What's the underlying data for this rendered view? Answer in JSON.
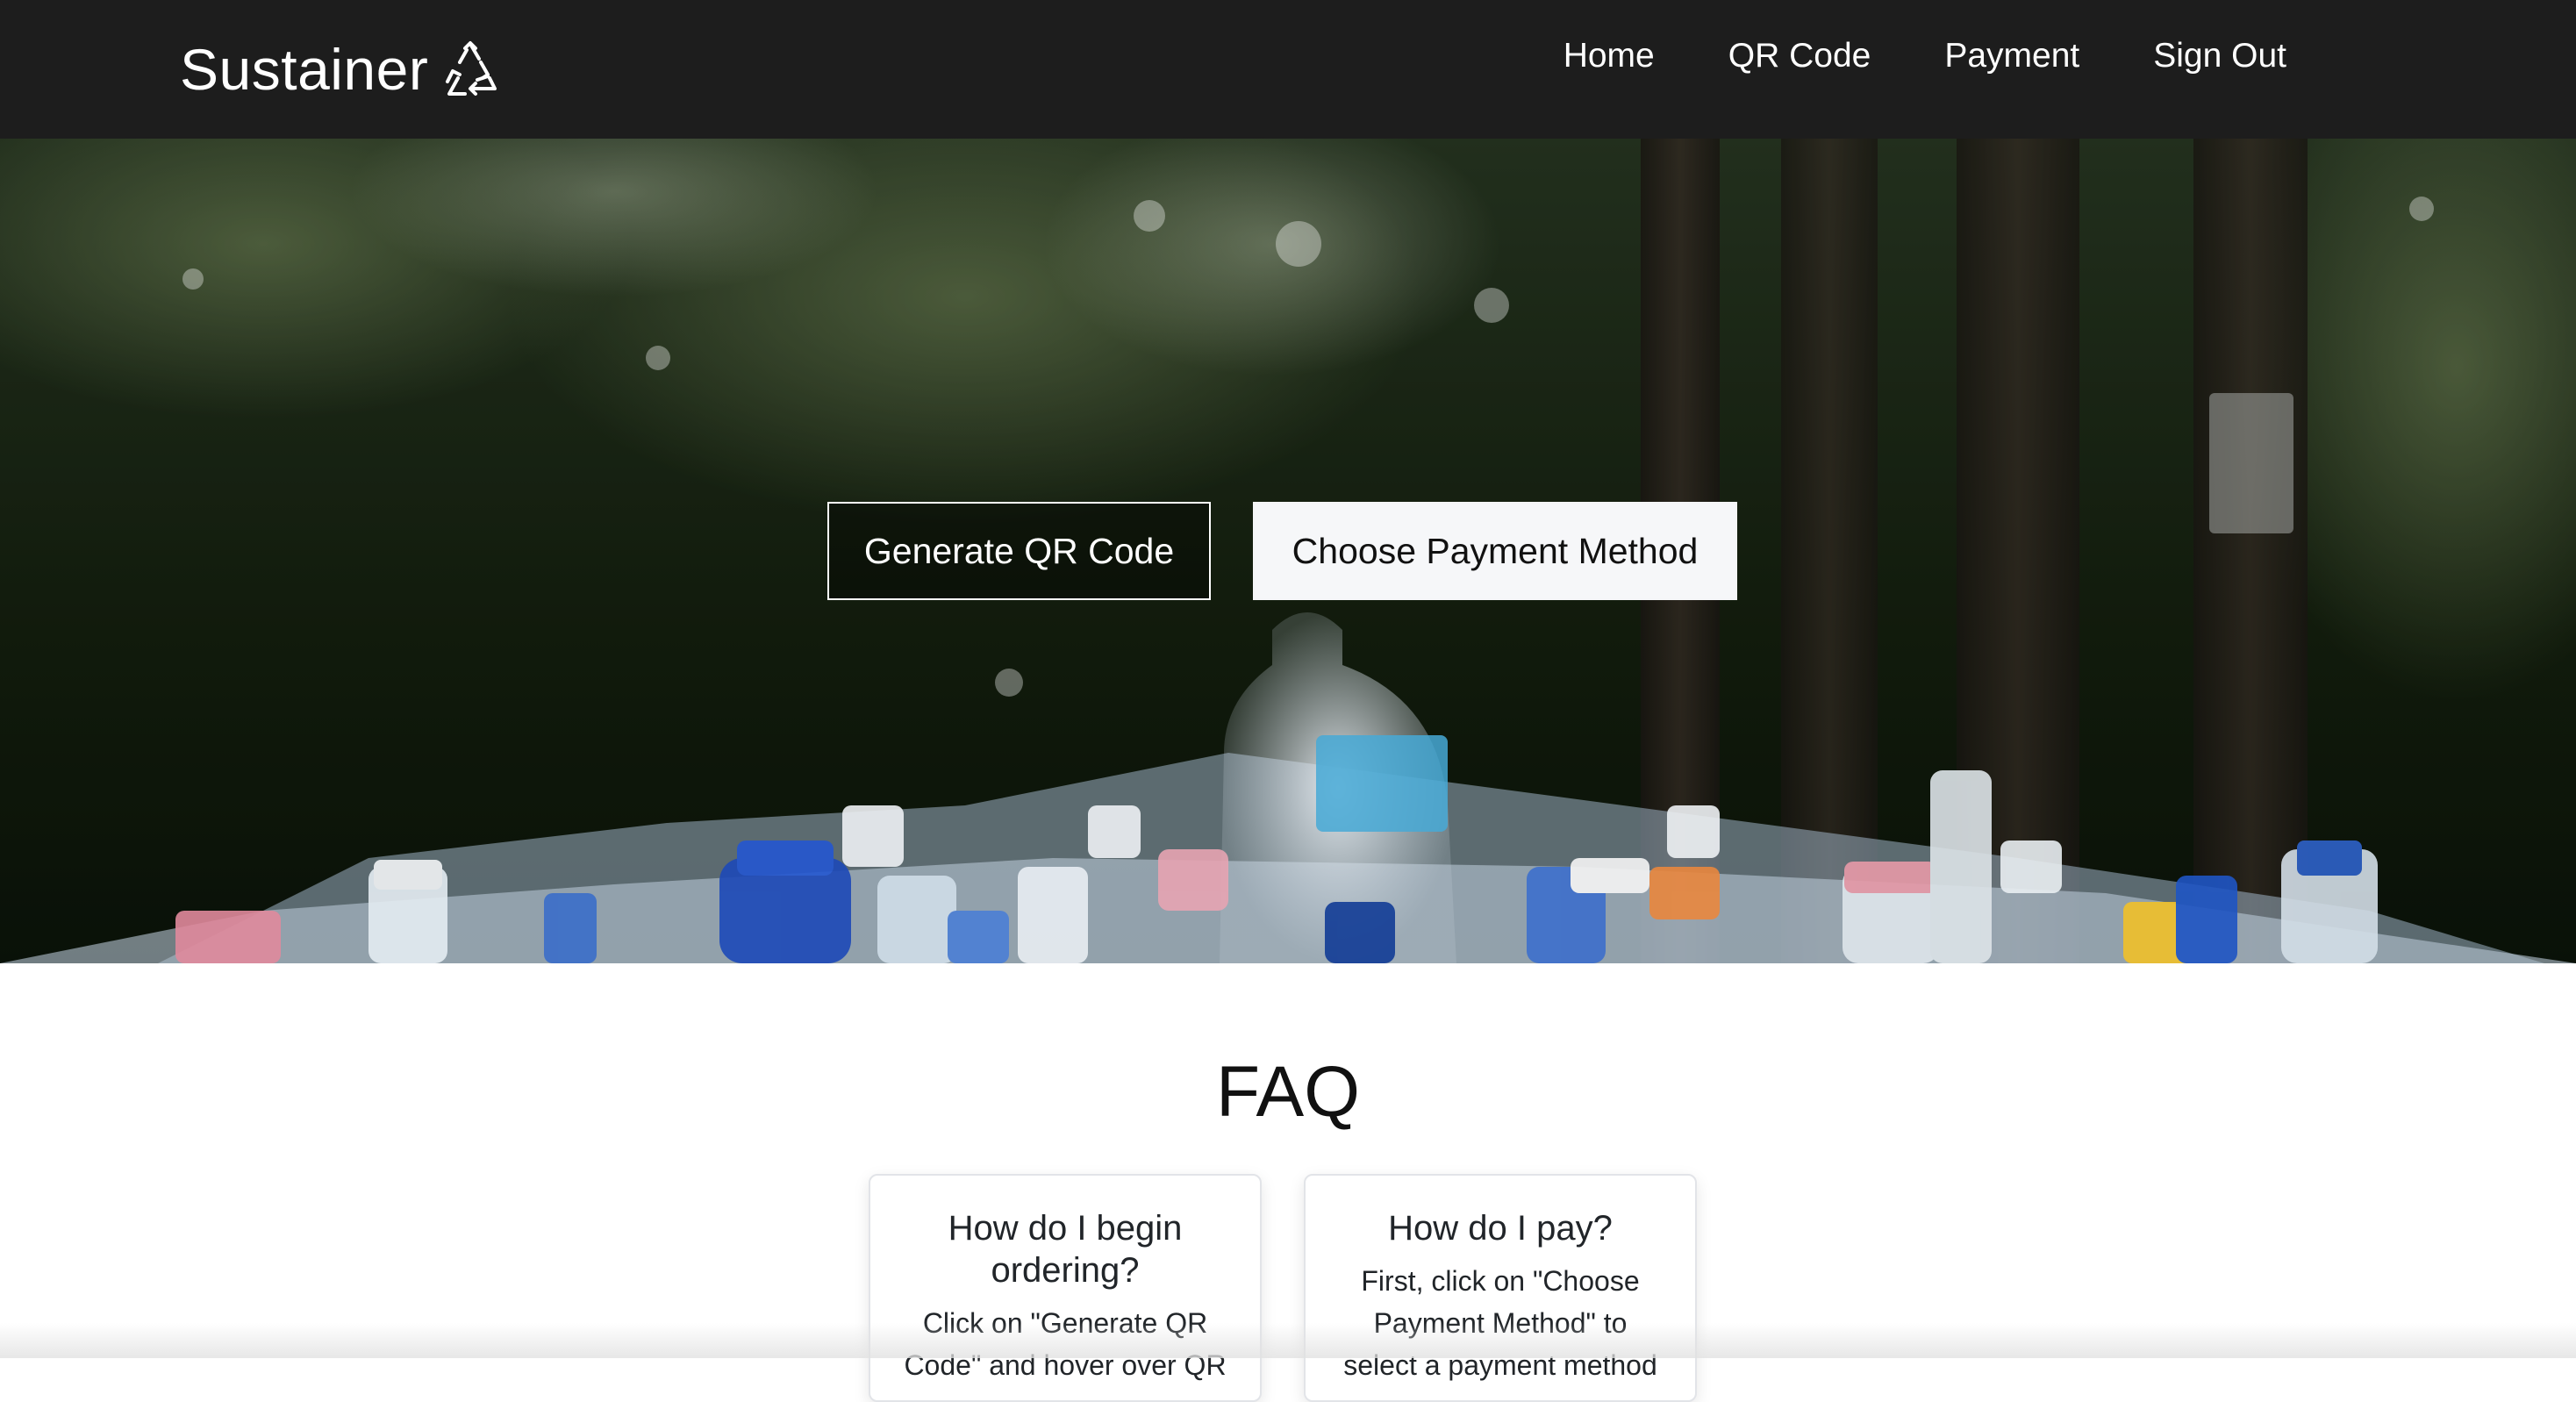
{
  "brand": {
    "name": "Sustainer",
    "icon": "recycle-icon"
  },
  "nav": {
    "items": [
      {
        "label": "Home"
      },
      {
        "label": "QR Code"
      },
      {
        "label": "Payment"
      },
      {
        "label": "Sign Out"
      }
    ]
  },
  "hero": {
    "image": "plastic-bottles-photo",
    "generate_button": "Generate QR Code",
    "payment_button": "Choose Payment Method"
  },
  "faq": {
    "title": "FAQ",
    "cards": [
      {
        "question": "How do I begin ordering?",
        "answer": "Click on \"Generate QR Code\" and hover over QR"
      },
      {
        "question": "How do I pay?",
        "answer": "First, click on \"Choose Payment Method\" to select a payment method"
      }
    ]
  },
  "colors": {
    "navbar": "#1d1d1d",
    "page": "#ffffff",
    "button_light": "#f6f7f9"
  }
}
